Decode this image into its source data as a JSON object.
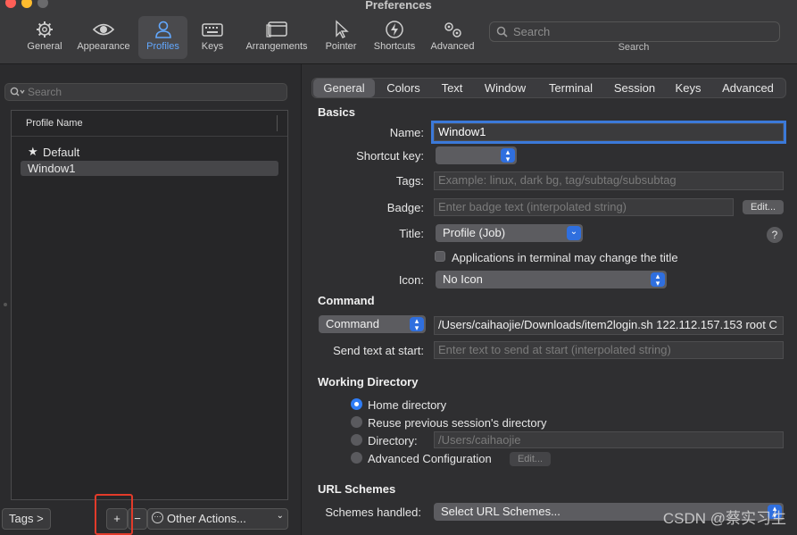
{
  "window": {
    "title": "Preferences"
  },
  "toolbar": {
    "items": [
      {
        "label": "General",
        "icon": "gear-icon"
      },
      {
        "label": "Appearance",
        "icon": "eye-icon"
      },
      {
        "label": "Profiles",
        "icon": "person-icon"
      },
      {
        "label": "Keys",
        "icon": "keyboard-icon"
      },
      {
        "label": "Arrangements",
        "icon": "window-icon"
      },
      {
        "label": "Pointer",
        "icon": "cursor-icon"
      },
      {
        "label": "Shortcuts",
        "icon": "bolt-icon"
      },
      {
        "label": "Advanced",
        "icon": "gears-icon"
      }
    ],
    "selected": "Profiles",
    "search_placeholder": "Search",
    "search_caption": "Search"
  },
  "profiles": {
    "search_placeholder": "Search",
    "column_header": "Profile Name",
    "rows": [
      {
        "name": "Default",
        "default": true
      },
      {
        "name": "Window1",
        "selected": true
      }
    ],
    "tags_button": "Tags >",
    "add_button": "+",
    "remove_button": "−",
    "other_actions": "Other Actions..."
  },
  "tabs": [
    "General",
    "Colors",
    "Text",
    "Window",
    "Terminal",
    "Session",
    "Keys",
    "Advanced"
  ],
  "selected_tab": "General",
  "basics": {
    "heading": "Basics",
    "name_label": "Name:",
    "name_value": "Window1",
    "shortcut_label": "Shortcut key:",
    "tags_label": "Tags:",
    "tags_placeholder": "Example: linux, dark bg, tag/subtag/subsubtag",
    "badge_label": "Badge:",
    "badge_placeholder": "Enter badge text (interpolated string)",
    "edit_button": "Edit...",
    "title_label": "Title:",
    "title_value": "Profile (Job)",
    "help": "?",
    "apps_change_title": "Applications in terminal may change the title",
    "icon_label": "Icon:",
    "icon_value": "No Icon"
  },
  "command": {
    "heading": "Command",
    "type_value": "Command",
    "command_value": "/Users/caihaojie/Downloads/item2login.sh 122.112.157.153 root C",
    "send_text_label": "Send text at start:",
    "send_text_placeholder": "Enter text to send at start (interpolated string)"
  },
  "working_directory": {
    "heading": "Working Directory",
    "options": [
      "Home directory",
      "Reuse previous session's directory",
      "Directory:",
      "Advanced Configuration"
    ],
    "selected": "Home directory",
    "directory_value": "/Users/caihaojie",
    "edit_button": "Edit..."
  },
  "url_schemes": {
    "heading": "URL Schemes",
    "handled_label": "Schemes handled:",
    "select_value": "Select URL Schemes..."
  },
  "watermark": "CSDN @蔡实习生",
  "colors": {
    "accent": "#2f7df6",
    "selected_tab": "#62a8ff",
    "highlight_box": "#e23b2a"
  }
}
